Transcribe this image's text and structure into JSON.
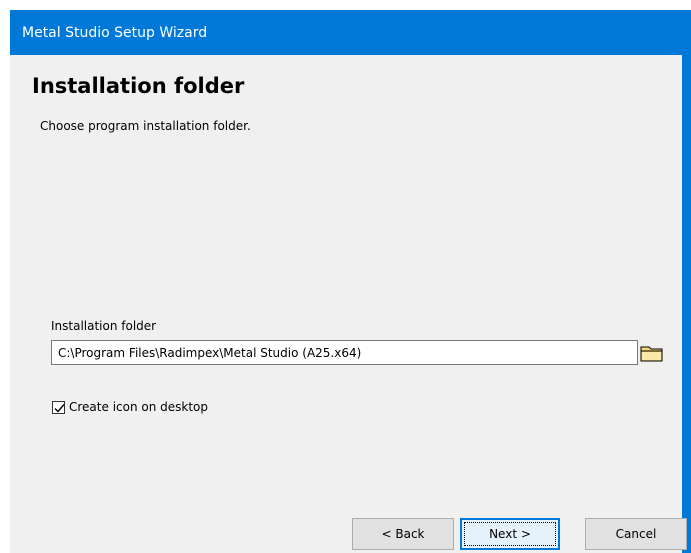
{
  "window": {
    "title": "Metal Studio Setup Wizard"
  },
  "page": {
    "heading": "Installation folder",
    "subheading": "Choose program installation folder."
  },
  "install_folder": {
    "label": "Installation folder",
    "value": "C:\\Program Files\\Radimpex\\Metal Studio (A25.x64)",
    "browse_icon": "folder-icon"
  },
  "desktop_icon": {
    "label": "Create icon on desktop",
    "checked": true
  },
  "buttons": {
    "back": "< Back",
    "next": "Next >",
    "cancel": "Cancel"
  },
  "colors": {
    "accent": "#0078d7",
    "content_bg": "#f0f0f0"
  }
}
